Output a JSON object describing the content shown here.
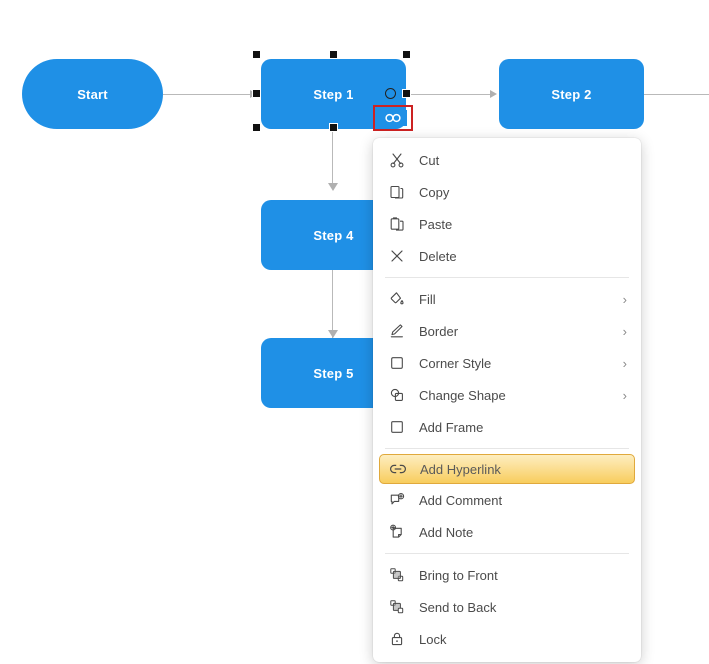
{
  "app": {
    "type": "flowchart-diagram-editor",
    "canvas_background": "#ffffff"
  },
  "colors": {
    "node_fill": "#1f90e6",
    "node_text": "#ffffff",
    "connector": "#b9b9b9",
    "menu_background": "#ffffff",
    "menu_text": "#4b4b4b",
    "highlight_border": "#e0a93c",
    "highlight_gradient_top": "#fdeec0",
    "highlight_gradient_bottom": "#f8cd5d",
    "selection_handle": "#111111",
    "attention_box_border": "#cc2222"
  },
  "diagram": {
    "nodes": [
      {
        "id": "start",
        "label": "Start",
        "shape": "pill",
        "selected": false
      },
      {
        "id": "step1",
        "label": "Step  1",
        "shape": "rounded",
        "selected": true
      },
      {
        "id": "step2",
        "label": "Step 2",
        "shape": "rounded",
        "selected": false
      },
      {
        "id": "step4",
        "label": "Step 4",
        "shape": "rounded",
        "selected": false
      },
      {
        "id": "step5",
        "label": "Step 5",
        "shape": "rounded",
        "selected": false
      }
    ],
    "selected_node": "step1",
    "shape_badge": {
      "name": "hyperlink-badge",
      "icon": "link-icon",
      "highlighted": true
    }
  },
  "context_menu": {
    "visible": true,
    "highlighted_item": "Add Hyperlink",
    "groups": [
      {
        "items": [
          {
            "label": "Cut",
            "icon": "scissors-icon",
            "submenu": false
          },
          {
            "label": "Copy",
            "icon": "copy-icon",
            "submenu": false
          },
          {
            "label": "Paste",
            "icon": "clipboard-icon",
            "submenu": false
          },
          {
            "label": "Delete",
            "icon": "close-x-icon",
            "submenu": false
          }
        ]
      },
      {
        "items": [
          {
            "label": "Fill",
            "icon": "paint-bucket-icon",
            "submenu": true,
            "chevron": "›"
          },
          {
            "label": "Border",
            "icon": "pen-icon",
            "submenu": true,
            "chevron": "›"
          },
          {
            "label": "Corner Style",
            "icon": "square-icon",
            "submenu": true,
            "chevron": "›"
          },
          {
            "label": "Change Shape",
            "icon": "shapes-icon",
            "submenu": true,
            "chevron": "›"
          },
          {
            "label": "Add Frame",
            "icon": "frame-icon",
            "submenu": false
          }
        ]
      },
      {
        "items": [
          {
            "label": "Add Hyperlink",
            "icon": "link-icon",
            "submenu": false,
            "highlighted": true
          },
          {
            "label": "Add Comment",
            "icon": "comment-plus-icon",
            "submenu": false
          },
          {
            "label": "Add Note",
            "icon": "note-plus-icon",
            "submenu": false
          }
        ]
      },
      {
        "items": [
          {
            "label": "Bring to Front",
            "icon": "bring-to-front-icon",
            "submenu": false
          },
          {
            "label": "Send to Back",
            "icon": "send-to-back-icon",
            "submenu": false
          },
          {
            "label": "Lock",
            "icon": "lock-icon",
            "submenu": false
          }
        ]
      }
    ]
  }
}
